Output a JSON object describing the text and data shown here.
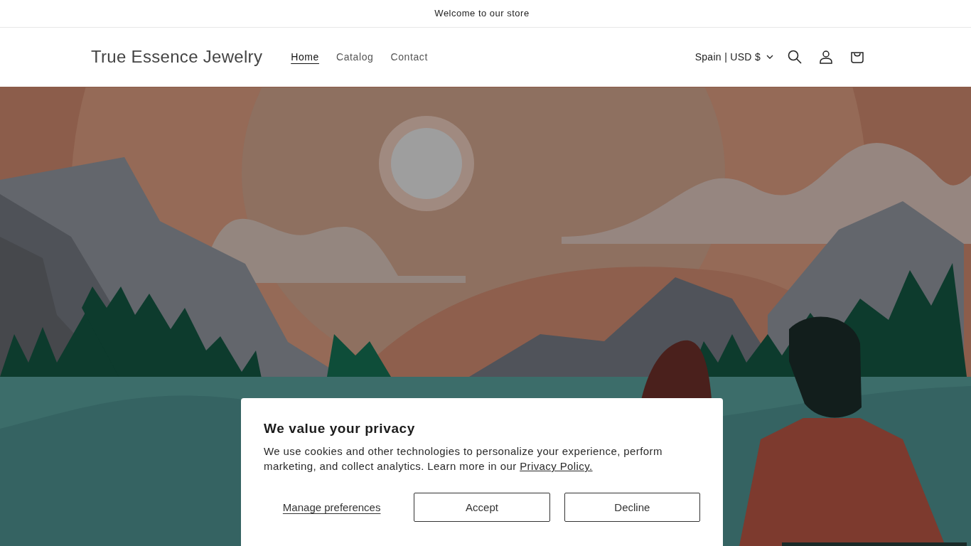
{
  "announcement": "Welcome to our store",
  "header": {
    "store_name": "True Essence Jewelry",
    "nav": [
      {
        "label": "Home",
        "selected": true
      },
      {
        "label": "Catalog",
        "selected": false
      },
      {
        "label": "Contact",
        "selected": false
      }
    ],
    "localization": "Spain | USD $"
  },
  "cookie_banner": {
    "title": "We value your privacy",
    "message": "We use cookies and other technologies to personalize your experience, perform marketing, and collect analytics. Learn more in our",
    "link": "Privacy Policy.",
    "buttons": [
      {
        "kind": "link",
        "label": "Manage preferences"
      },
      {
        "kind": "outline",
        "label": "Accept"
      },
      {
        "kind": "outline",
        "label": "Decline"
      }
    ]
  }
}
